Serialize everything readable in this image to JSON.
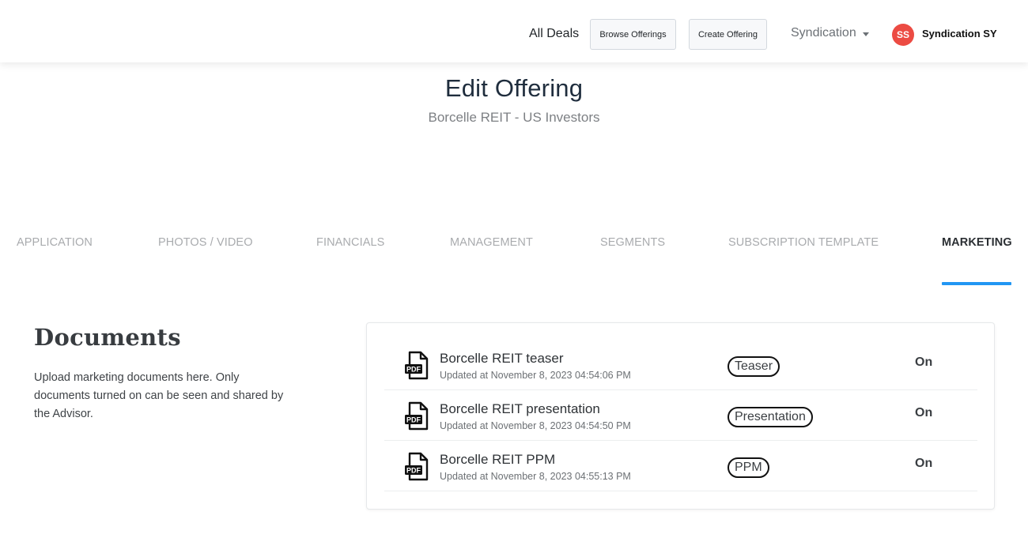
{
  "header": {
    "nav_link": "All Deals",
    "buttons": [
      "Browse Offerings",
      "Create Offering"
    ],
    "dropdown": {
      "label": "Syndication",
      "icon": "caret-down-icon"
    },
    "user": {
      "initials": "SS",
      "name": "Syndication SY",
      "avatar_color": "#ec4b43"
    }
  },
  "page": {
    "title": "Edit Offering",
    "subtitle": "Borcelle REIT - US Investors"
  },
  "tabs": [
    {
      "label": "APPLICATION",
      "active": false
    },
    {
      "label": "PHOTOS / VIDEO",
      "active": false
    },
    {
      "label": "FINANCIALS",
      "active": false
    },
    {
      "label": "MANAGEMENT",
      "active": false
    },
    {
      "label": "SEGMENTS",
      "active": false
    },
    {
      "label": "SUBSCRIPTION TEMPLATE",
      "active": false
    },
    {
      "label": "MARKETING",
      "active": true
    }
  ],
  "accent_color": "#2196f3",
  "documents": {
    "heading": "Documents",
    "description": "Upload marketing documents here. Only documents turned on can be seen and shared by the Advisor.",
    "items": [
      {
        "icon": "pdf-file-icon",
        "name": "Borcelle REIT teaser",
        "updated": "Updated at November 8, 2023 04:54:06 PM",
        "tag": "Teaser",
        "status": "On"
      },
      {
        "icon": "pdf-file-icon",
        "name": "Borcelle REIT presentation",
        "updated": "Updated at November 8, 2023 04:54:50 PM",
        "tag": "Presentation",
        "status": "On"
      },
      {
        "icon": "pdf-file-icon",
        "name": "Borcelle REIT PPM",
        "updated": "Updated at November 8, 2023 04:55:13 PM",
        "tag": "PPM",
        "status": "On"
      }
    ]
  }
}
